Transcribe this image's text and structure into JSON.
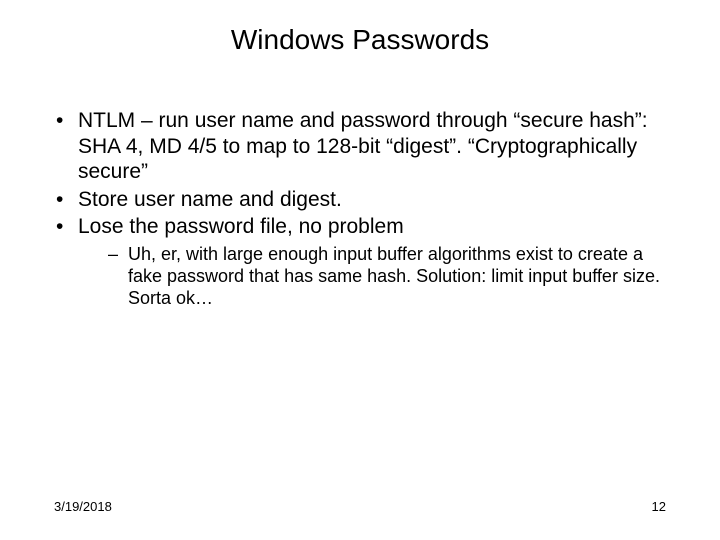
{
  "slide": {
    "title": "Windows Passwords",
    "bullets": [
      "NTLM – run user name and password through “secure hash”: SHA 4, MD 4/5 to map to 128-bit “digest”. “Cryptographically secure”",
      "Store user name and digest.",
      "Lose the password file, no problem"
    ],
    "sub_bullet": "Uh, er, with large enough input buffer algorithms exist to create a fake password that has same hash. Solution: limit input buffer size. Sorta ok…",
    "footer": {
      "date": "3/19/2018",
      "page": "12"
    }
  }
}
